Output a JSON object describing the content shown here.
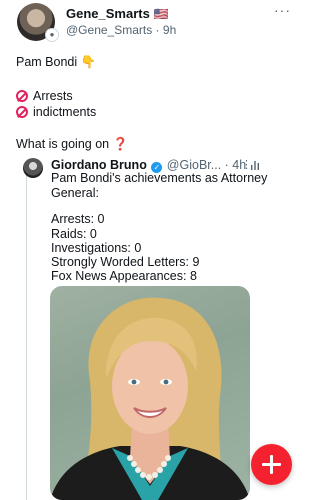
{
  "post": {
    "display_name": "Gene_Smarts",
    "flag": "🇺🇸",
    "handle": "@Gene_Smarts",
    "separator": " · ",
    "time": "9h",
    "more": "···",
    "line1": "Pam Bondi 👇",
    "line2": "Arrests",
    "line3": "indictments",
    "line4": "What is going on ",
    "question_emoji": "❓"
  },
  "quote": {
    "name": "Giordano Bruno",
    "handle": "@GioBr...",
    "separator": " · ",
    "time": "4h",
    "more": "⋮",
    "text": [
      "Pam Bondi's achievements as Attorney",
      "General:",
      "",
      "Arrests: 0",
      "Raids: 0",
      "Investigations: 0",
      "Strongly Worded Letters: 9",
      "Fox News Appearances: 8"
    ]
  },
  "icons": {
    "more": "more-horizontal-icon",
    "verified": "verified-badge-icon",
    "stats": "stats-icon",
    "no_sign": "prohibited-icon",
    "compose": "plus-icon"
  },
  "colors": {
    "fab": "#f4212e",
    "verified": "#1d9bf0",
    "secondary_text": "#536471",
    "emoji_red": "#e0245e"
  }
}
